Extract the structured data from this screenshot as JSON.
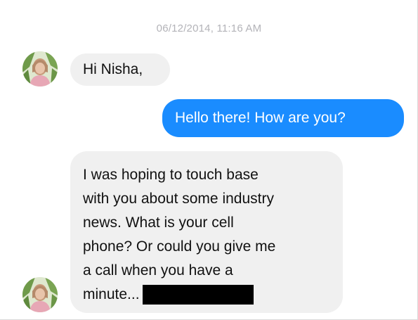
{
  "conversation": {
    "timestamp": "06/12/2014, 11:16 AM",
    "messages": [
      {
        "direction": "incoming",
        "lines": [
          "Hi Nisha,"
        ]
      },
      {
        "direction": "outgoing",
        "lines": [
          "Hello there! How are you?"
        ]
      },
      {
        "direction": "incoming",
        "lines": [
          "I was hoping to touch base",
          "with you about some industry",
          "news. What is your cell",
          "phone? Or could you give me",
          "a call when you have a",
          "minute..."
        ],
        "redacted": true
      }
    ]
  },
  "colors": {
    "incoming_bubble": "#f0f0f0",
    "outgoing_bubble": "#1a8cff",
    "timestamp_text": "#b3b3b8",
    "redaction": "#000000"
  },
  "icons": {
    "avatar": "contact-avatar"
  }
}
